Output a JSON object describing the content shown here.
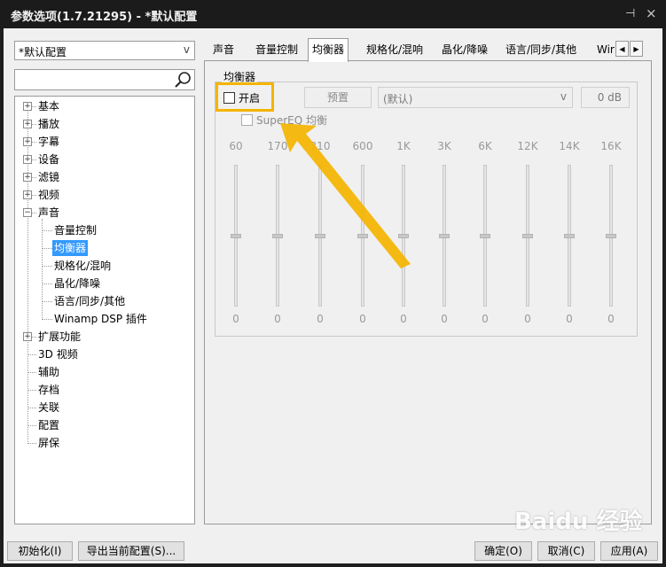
{
  "window": {
    "title": "参数选项(1.7.21295) - *默认配置",
    "pin_glyph": "⊣",
    "close_glyph": "×"
  },
  "left": {
    "profile": {
      "value": "*默认配置",
      "chevron": "v"
    },
    "tree": [
      {
        "label": "基本",
        "expander": "+"
      },
      {
        "label": "播放",
        "expander": "+"
      },
      {
        "label": "字幕",
        "expander": "+"
      },
      {
        "label": "设备",
        "expander": "+"
      },
      {
        "label": "滤镜",
        "expander": "+"
      },
      {
        "label": "视频",
        "expander": "+"
      },
      {
        "label": "声音",
        "expander": "−"
      },
      {
        "label": "音量控制"
      },
      {
        "label": "均衡器",
        "selected": true
      },
      {
        "label": "规格化/混响"
      },
      {
        "label": "晶化/降噪"
      },
      {
        "label": "语言/同步/其他"
      },
      {
        "label": "Winamp DSP 插件"
      },
      {
        "label": "扩展功能",
        "expander": "+"
      },
      {
        "label": "3D 视频"
      },
      {
        "label": "辅助"
      },
      {
        "label": "存档"
      },
      {
        "label": "关联"
      },
      {
        "label": "配置"
      },
      {
        "label": "屏保"
      }
    ]
  },
  "tabs": [
    {
      "label": "声音"
    },
    {
      "label": "音量控制"
    },
    {
      "label": "均衡器",
      "active": true
    },
    {
      "label": "规格化/混响"
    },
    {
      "label": "晶化/降噪"
    },
    {
      "label": "语言/同步/其他"
    },
    {
      "label": "Wir"
    }
  ],
  "tab_scroll": {
    "left": "◀",
    "right": "▶"
  },
  "equalizer": {
    "group_title": "均衡器",
    "enable_label": "开启",
    "enable_checked": false,
    "superEQ_label": "SuperEQ 均衡",
    "preset_button": "预置",
    "preset_select": "(默认)",
    "preset_chevron": "v",
    "gain": "0 dB",
    "bands": [
      {
        "freq": "60",
        "value": "0"
      },
      {
        "freq": "170",
        "value": "0"
      },
      {
        "freq": "310",
        "value": "0"
      },
      {
        "freq": "600",
        "value": "0"
      },
      {
        "freq": "1K",
        "value": "0"
      },
      {
        "freq": "3K",
        "value": "0"
      },
      {
        "freq": "6K",
        "value": "0"
      },
      {
        "freq": "12K",
        "value": "0"
      },
      {
        "freq": "14K",
        "value": "0"
      },
      {
        "freq": "16K",
        "value": "0"
      }
    ]
  },
  "bottom": {
    "init": "初始化(I)",
    "export": "导出当前配置(S)...",
    "ok": "确定(O)",
    "cancel": "取消(C)",
    "apply": "应用(A)"
  },
  "watermark": "Baidu 经验",
  "colors": {
    "highlight": "#f5b400",
    "selection": "#3399ff",
    "titlebar": "#1b1b1b"
  }
}
